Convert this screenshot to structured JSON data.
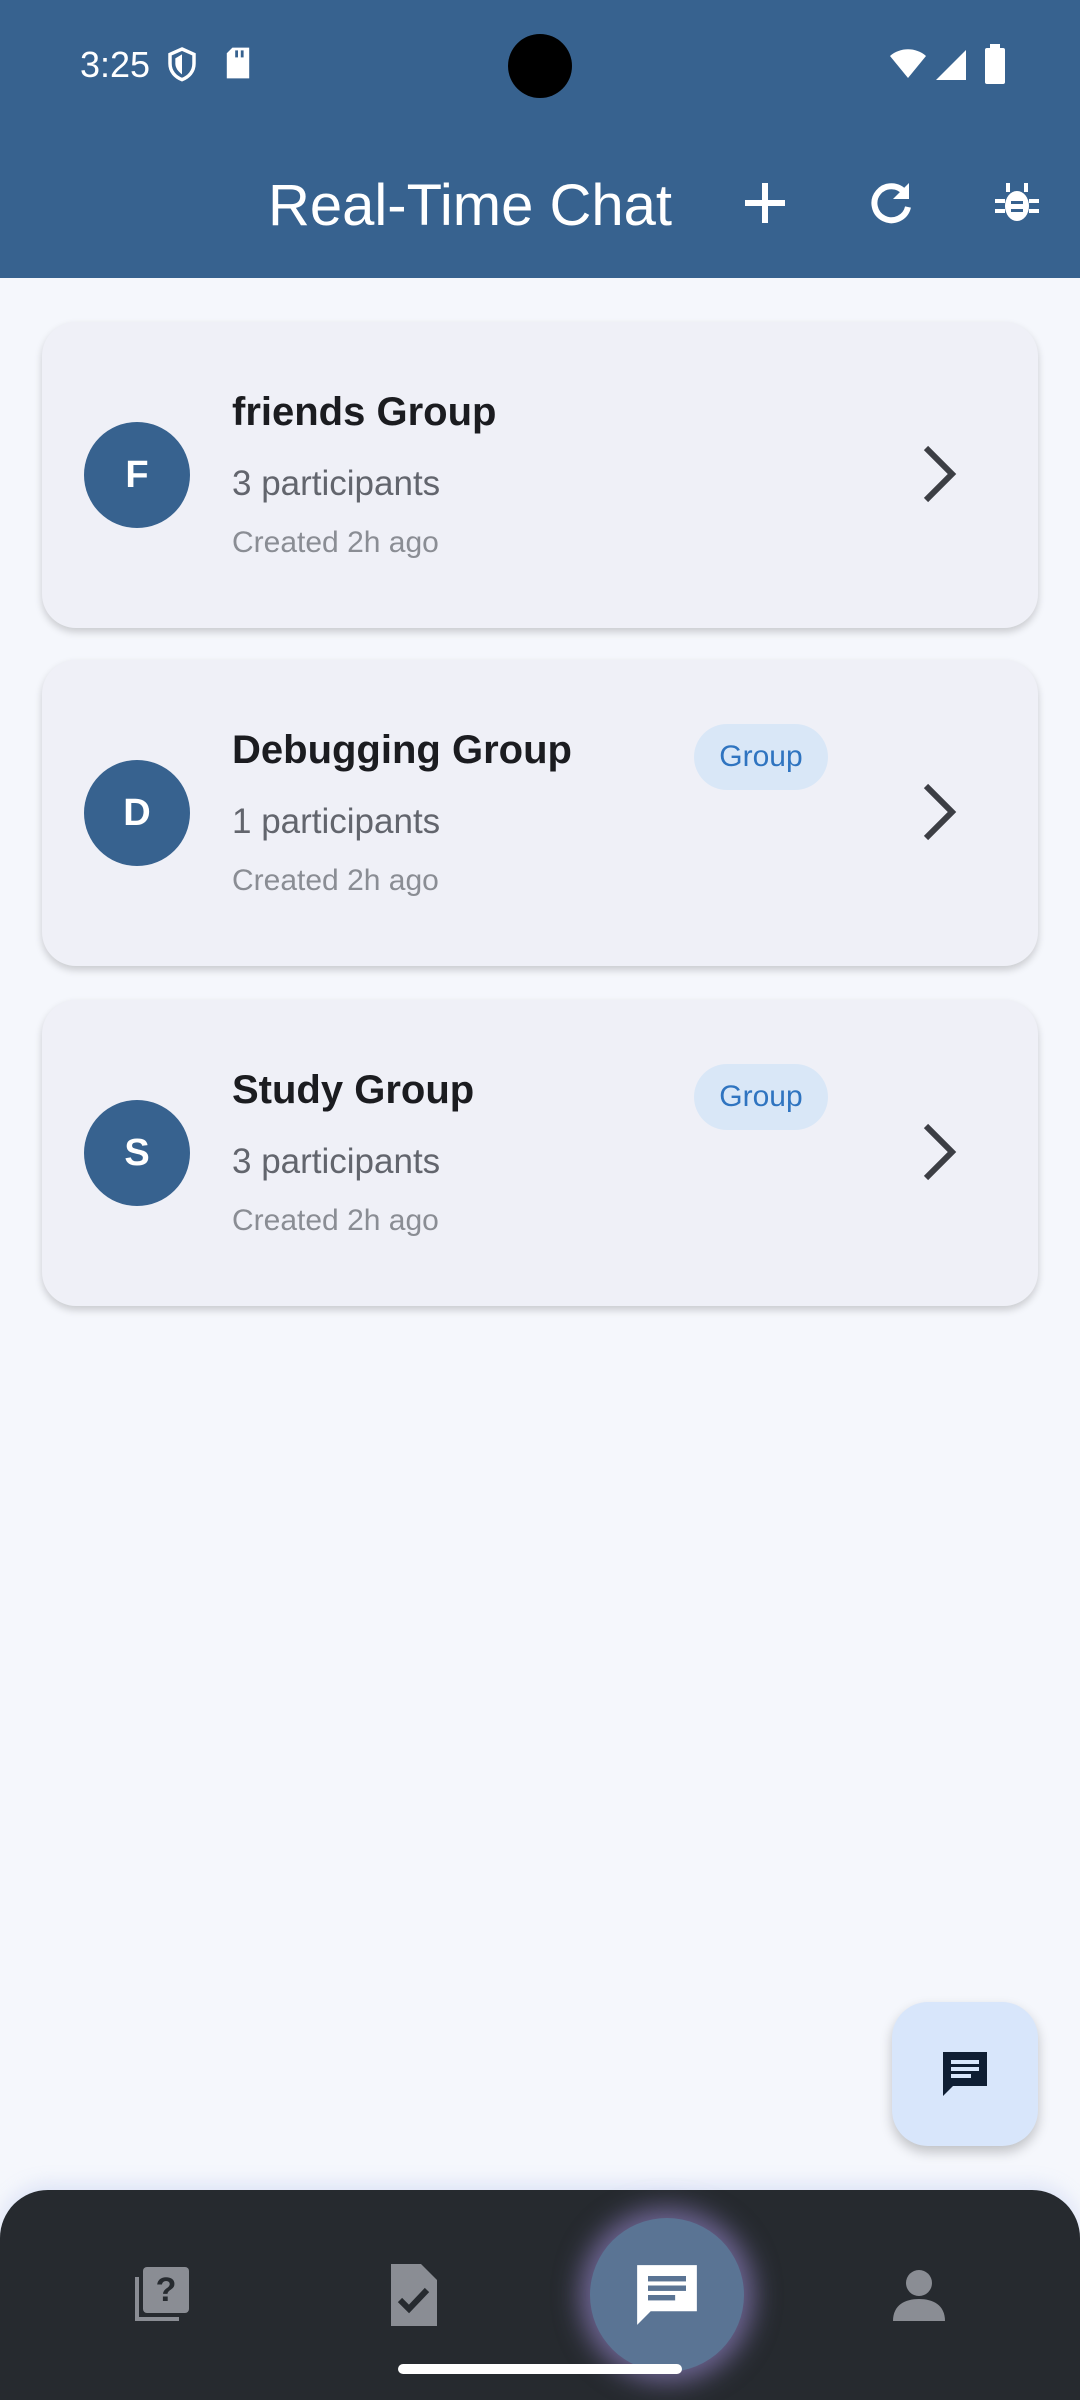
{
  "status_bar": {
    "time": "3:25"
  },
  "app_bar": {
    "title": "Real-Time Chat",
    "actions": [
      "add-icon",
      "refresh-icon",
      "bug-icon"
    ]
  },
  "chats": [
    {
      "initial": "F",
      "name": "friends Group",
      "participants": "3 participants",
      "created": "Created 2h ago",
      "badge": ""
    },
    {
      "initial": "D",
      "name": "Debugging Group",
      "participants": "1 participants",
      "created": "Created 2h ago",
      "badge": "Group"
    },
    {
      "initial": "S",
      "name": "Study Group",
      "participants": "3 participants",
      "created": "Created 2h ago",
      "badge": "Group"
    }
  ],
  "fab": {
    "icon": "chat-icon"
  },
  "bottom_nav": {
    "items": [
      "quiz-icon",
      "assignment-icon",
      "chat-icon",
      "profile-icon"
    ],
    "active_index": 2
  },
  "colors": {
    "primary": "#37628f",
    "background": "#f5f7fc",
    "card": "#eff0f7",
    "badge_bg": "#d9e7f7",
    "badge_text": "#2f74c0",
    "nav_bg": "#262a2f"
  }
}
